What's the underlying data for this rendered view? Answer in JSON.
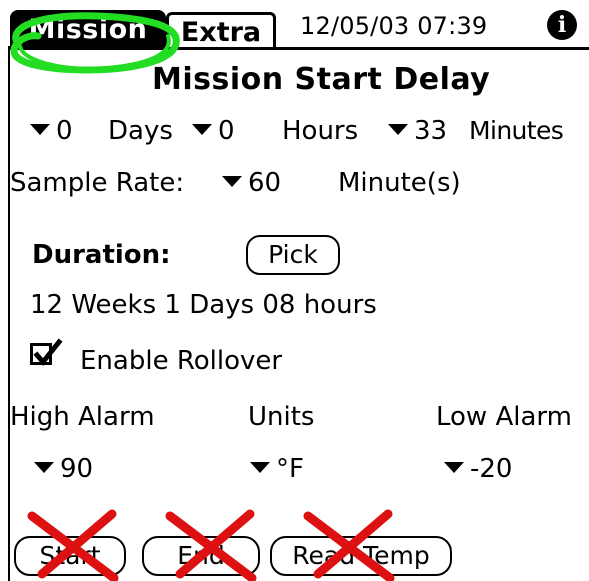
{
  "tabs": {
    "mission": "Mission",
    "extra": "Extra"
  },
  "header": {
    "datetime": "12/05/03 07:39",
    "info_icon": "i"
  },
  "mission_start_delay": {
    "title": "Mission Start Delay",
    "days_value": "0",
    "days_label": "Days",
    "hours_value": "0",
    "hours_label": "Hours",
    "minutes_value": "33",
    "minutes_label": "Minutes"
  },
  "sample_rate": {
    "label": "Sample Rate:",
    "value": "60",
    "unit": "Minute(s)"
  },
  "duration": {
    "label": "Duration:",
    "pick_label": "Pick",
    "value": "12 Weeks 1 Days 08 hours"
  },
  "rollover": {
    "label": "Enable Rollover",
    "checked": true
  },
  "alarms": {
    "high_label": "High Alarm",
    "units_label": "Units",
    "low_label": "Low Alarm",
    "high_value": "90",
    "units_value": "°F",
    "low_value": "-20"
  },
  "buttons": {
    "start": "Start",
    "end": "End",
    "read_temp": "Read Temp"
  },
  "colors": {
    "highlight_circle": "#22dd22",
    "strike_mark": "#dd1111"
  }
}
